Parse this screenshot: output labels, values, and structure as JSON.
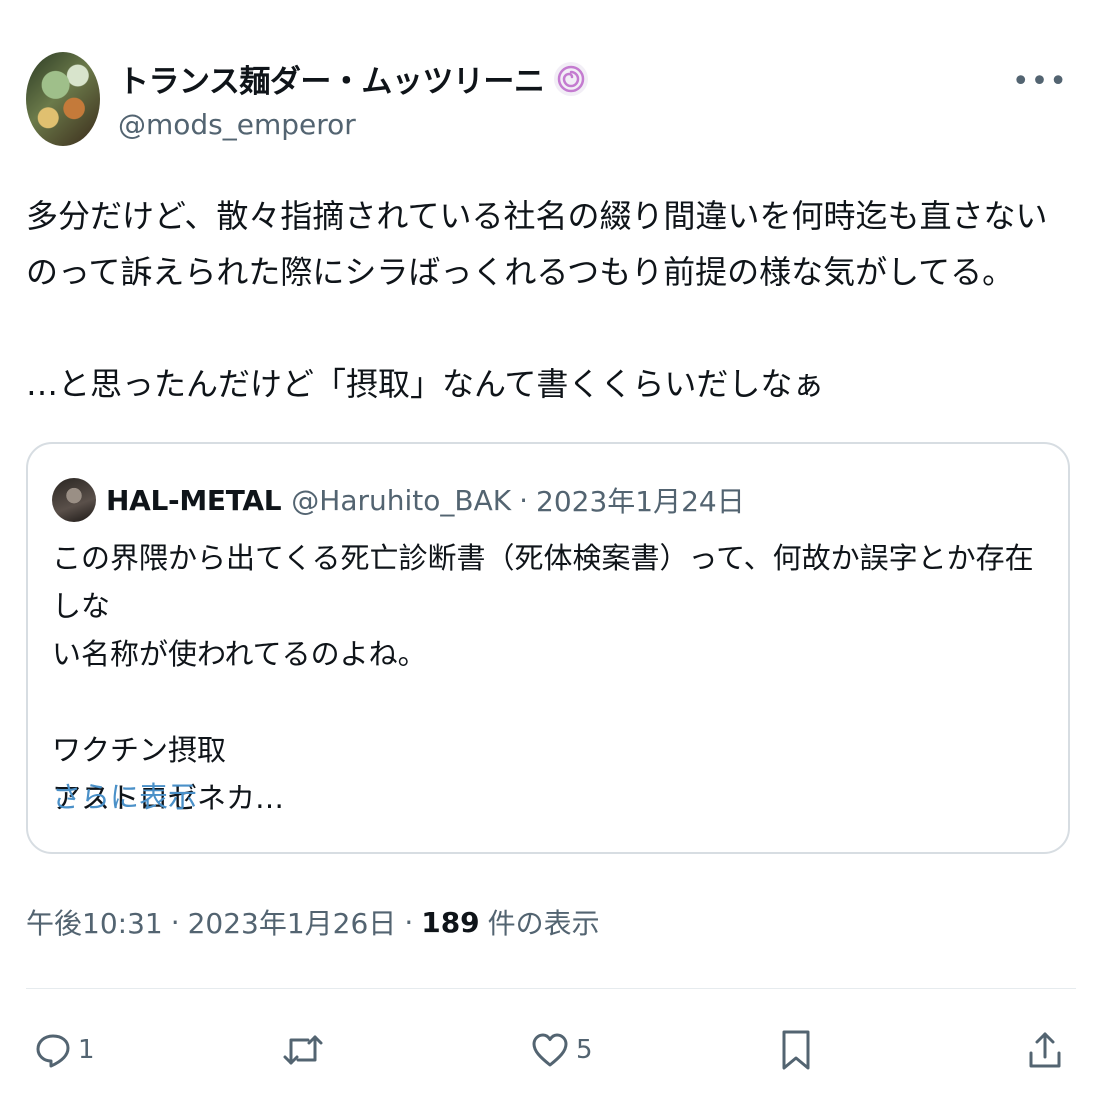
{
  "tweet": {
    "display_name": "トランス麺ダー・ムッツリーニ",
    "handle": "@mods_emperor",
    "more_label": "•••",
    "text": "多分だけど、散々指摘されている社名の綴り間違いを何時迄も直さない\nのって訴えられた際にシラばっくれるつもり前提の様な気がしてる。\n\n…と思ったんだけど「摂取」なんて書くくらいだしなぁ"
  },
  "quote": {
    "name": "HAL-METAL",
    "handle": "@Haruhito_BAK",
    "dot": "·",
    "date": "2023年1月24日",
    "text": "この界隈から出てくる死亡診断書（死体検案書）って、何故か誤字とか存在しな\nい名称が使われてるのよね。\n\nワクチン摂取\nアストロゼネカ…",
    "show_more": "さらに表示"
  },
  "meta": {
    "time": "午後10:31",
    "dot1": "·",
    "date": "2023年1月26日",
    "dot2": "·",
    "views_count": "189",
    "views_label": "件の表示"
  },
  "actions": {
    "reply_count": "1",
    "like_count": "5"
  },
  "colors": {
    "link": "#4a90c8",
    "secondary_text": "#536471",
    "badge": "#c47bd0"
  },
  "icons": [
    "swirl-badge-icon",
    "more-icon",
    "reply-icon",
    "retweet-icon",
    "like-icon",
    "bookmark-icon",
    "share-icon"
  ]
}
